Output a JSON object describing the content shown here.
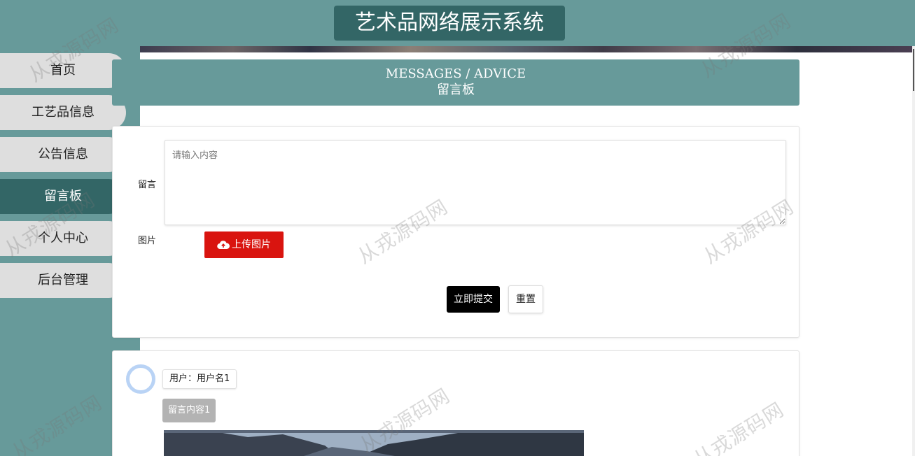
{
  "header": {
    "title": "艺术品网络展示系统"
  },
  "sidebar": {
    "items": [
      {
        "label": "首页",
        "active": false
      },
      {
        "label": "工艺品信息",
        "active": false
      },
      {
        "label": "公告信息",
        "active": false
      },
      {
        "label": "留言板",
        "active": true
      },
      {
        "label": "个人中心",
        "active": false
      },
      {
        "label": "后台管理",
        "active": false
      }
    ]
  },
  "page_header": {
    "title_en": "MESSAGES / ADVICE",
    "title_cn": "留言板"
  },
  "form": {
    "message_label": "留言",
    "message_placeholder": "请输入内容",
    "image_label": "图片",
    "upload_button": "上传图片",
    "submit_button": "立即提交",
    "reset_button": "重置"
  },
  "messages": [
    {
      "user": "用户：用户名1",
      "content": "留言内容1"
    }
  ],
  "watermark": "从戎源码网",
  "colors": {
    "header_bg": "#679a9a",
    "title_bg": "#336666",
    "upload": "#d9140f",
    "submit": "#000000"
  }
}
